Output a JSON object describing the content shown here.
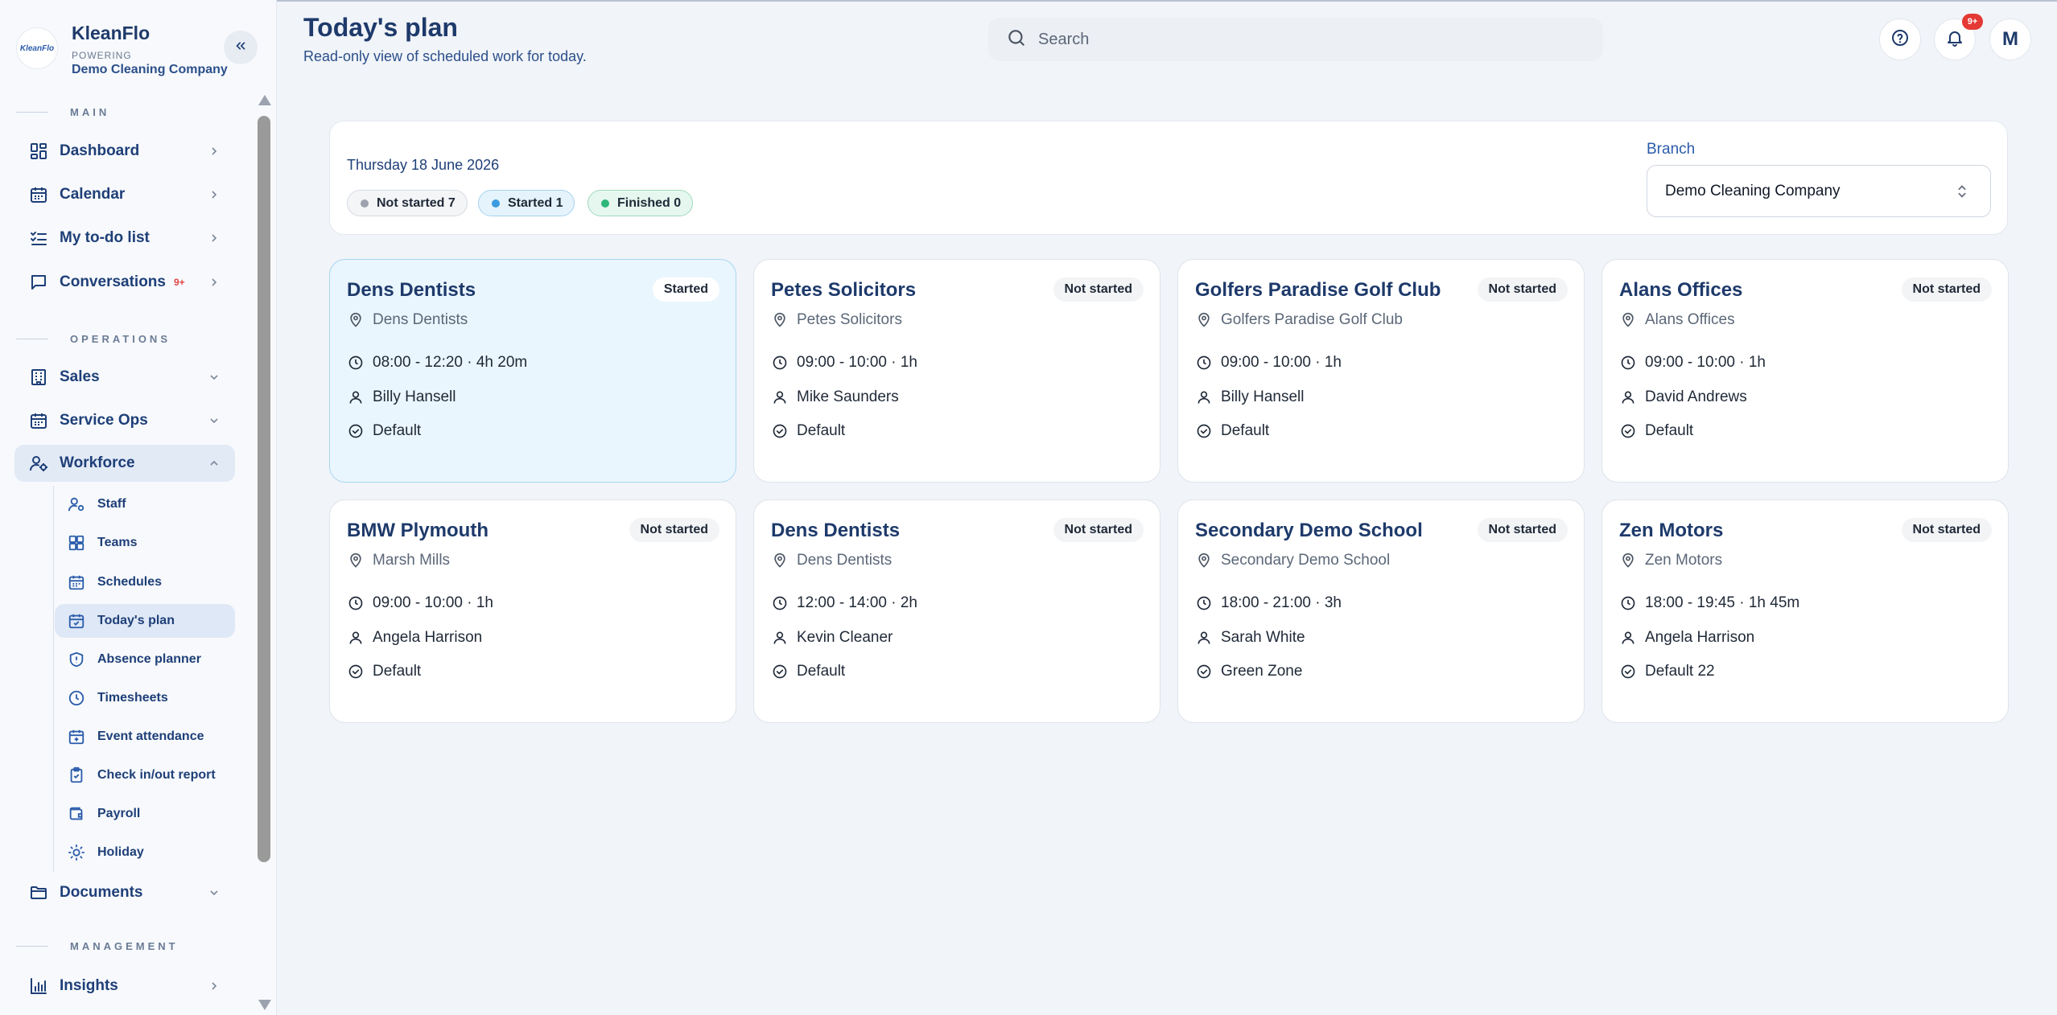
{
  "brand": {
    "logo_text": "KleanFlo",
    "name": "KleanFlo",
    "powering": "POWERING",
    "company": "Demo Cleaning Company"
  },
  "sidebar": {
    "sections": {
      "main": "MAIN",
      "operations": "OPERATIONS",
      "management": "MANAGEMENT"
    },
    "items": [
      {
        "label": "Dashboard",
        "icon": "dashboard-icon",
        "chevron": "right"
      },
      {
        "label": "Calendar",
        "icon": "calendar-icon",
        "chevron": "right"
      },
      {
        "label": "My to-do list",
        "icon": "checklist-icon",
        "chevron": "right"
      },
      {
        "label": "Conversations",
        "icon": "chat-icon",
        "badge": "9+",
        "chevron": "right"
      },
      {
        "label": "Sales",
        "icon": "building-icon",
        "chevron": "down"
      },
      {
        "label": "Service Ops",
        "icon": "calendar-icon",
        "chevron": "down"
      },
      {
        "label": "Workforce",
        "icon": "user-gear-icon",
        "chevron": "up"
      },
      {
        "label": "Documents",
        "icon": "folder-icon",
        "chevron": "down"
      },
      {
        "label": "Insights",
        "icon": "bar-chart-icon",
        "chevron": "right"
      }
    ],
    "workforce_children": [
      {
        "label": "Staff",
        "icon": "user-gear-icon"
      },
      {
        "label": "Teams",
        "icon": "grid-icon"
      },
      {
        "label": "Schedules",
        "icon": "calendar-icon"
      },
      {
        "label": "Today's plan",
        "icon": "calendar-check-icon",
        "active": true
      },
      {
        "label": "Absence planner",
        "icon": "shield-icon"
      },
      {
        "label": "Timesheets",
        "icon": "clock-icon"
      },
      {
        "label": "Event attendance",
        "icon": "calendar-plus-icon"
      },
      {
        "label": "Check in/out report",
        "icon": "clipboard-check-icon"
      },
      {
        "label": "Payroll",
        "icon": "wallet-icon"
      },
      {
        "label": "Holiday",
        "icon": "sun-icon"
      }
    ]
  },
  "header": {
    "title": "Today's plan",
    "subtitle": "Read-only view of scheduled work for today.",
    "search_placeholder": "Search",
    "notifications_badge": "9+",
    "avatar_initial": "M"
  },
  "filters": {
    "date": "Thursday 18 June 2026",
    "chips": {
      "not_started": "Not started 7",
      "started": "Started 1",
      "finished": "Finished 0"
    },
    "branch_label": "Branch",
    "branch_value": "Demo Cleaning Company"
  },
  "jobs": [
    {
      "title": "Dens Dentists",
      "status": "Started",
      "location": "Dens Dentists",
      "time": "08:00 - 12:20 · 4h 20m",
      "staff": "Billy Hansell",
      "zone": "Default"
    },
    {
      "title": "Petes Solicitors",
      "status": "Not started",
      "location": "Petes Solicitors",
      "time": "09:00 - 10:00 · 1h",
      "staff": "Mike Saunders",
      "zone": "Default"
    },
    {
      "title": "Golfers Paradise Golf Club",
      "status": "Not started",
      "location": "Golfers Paradise Golf Club",
      "time": "09:00 - 10:00 · 1h",
      "staff": "Billy Hansell",
      "zone": "Default"
    },
    {
      "title": "Alans Offices",
      "status": "Not started",
      "location": "Alans Offices",
      "time": "09:00 - 10:00 · 1h",
      "staff": "David Andrews",
      "zone": "Default"
    },
    {
      "title": "BMW Plymouth",
      "status": "Not started",
      "location": "Marsh Mills",
      "time": "09:00 - 10:00 · 1h",
      "staff": "Angela Harrison",
      "zone": "Default"
    },
    {
      "title": "Dens Dentists",
      "status": "Not started",
      "location": "Dens Dentists",
      "time": "12:00 - 14:00 · 2h",
      "staff": "Kevin Cleaner",
      "zone": "Default"
    },
    {
      "title": "Secondary Demo School",
      "status": "Not started",
      "location": "Secondary Demo School",
      "time": "18:00 - 21:00 · 3h",
      "staff": "Sarah White",
      "zone": "Green Zone"
    },
    {
      "title": "Zen Motors",
      "status": "Not started",
      "location": "Zen Motors",
      "time": "18:00 - 19:45 · 1h 45m",
      "staff": "Angela Harrison",
      "zone": "Default 22"
    }
  ],
  "colors": {
    "brand_navy": "#1e3a6b",
    "started_bg": "#eaf6fd",
    "started_dot": "#3b9be0",
    "finished_dot": "#2fb67a",
    "not_started_dot": "#9ca3af",
    "badge_red": "#e53935"
  }
}
